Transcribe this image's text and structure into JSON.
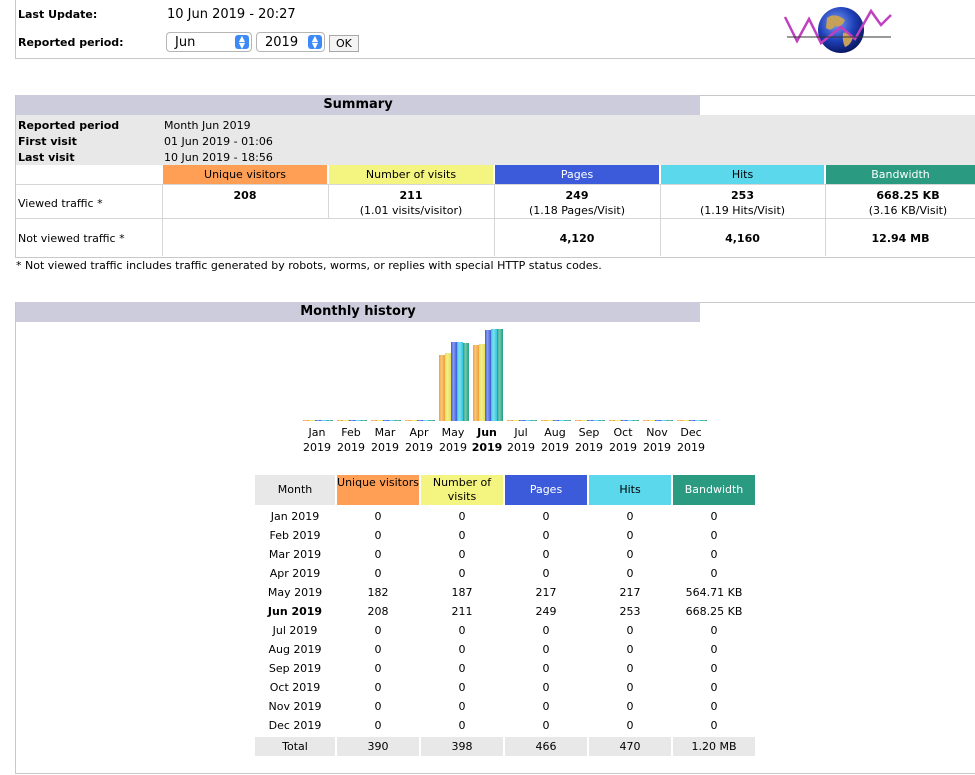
{
  "header": {
    "last_update_label": "Last Update:",
    "last_update_value": "10 Jun 2019 - 20:27",
    "reported_period_label": "Reported period:",
    "month_select": "Jun",
    "year_select": "2019",
    "ok_label": "OK"
  },
  "summary": {
    "title": "Summary",
    "rows": [
      {
        "label": "Reported period",
        "value": "Month Jun 2019"
      },
      {
        "label": "First visit",
        "value": "01 Jun 2019 - 01:06"
      },
      {
        "label": "Last visit",
        "value": "10 Jun 2019 - 18:56"
      }
    ],
    "headers": {
      "unique": "Unique visitors",
      "visits": "Number of visits",
      "pages": "Pages",
      "hits": "Hits",
      "bandwidth": "Bandwidth"
    },
    "viewed": {
      "label": "Viewed traffic *",
      "unique": "208",
      "visits": "211",
      "visits_sub": "(1.01 visits/visitor)",
      "pages": "249",
      "pages_sub": "(1.18 Pages/Visit)",
      "hits": "253",
      "hits_sub": "(1.19 Hits/Visit)",
      "bandwidth": "668.25 KB",
      "bandwidth_sub": "(3.16 KB/Visit)"
    },
    "not_viewed": {
      "label": "Not viewed traffic *",
      "pages": "4,120",
      "hits": "4,160",
      "bandwidth": "12.94 MB"
    },
    "footnote": "* Not viewed traffic includes traffic generated by robots, worms, or replies with special HTTP status codes."
  },
  "history": {
    "title": "Monthly history",
    "months": [
      "Jan",
      "Feb",
      "Mar",
      "Apr",
      "May",
      "Jun",
      "Jul",
      "Aug",
      "Sep",
      "Oct",
      "Nov",
      "Dec"
    ],
    "year": "2019",
    "current_month_index": 5,
    "table_headers": {
      "month": "Month",
      "unique": "Unique visitors",
      "visits": "Number of visits",
      "pages": "Pages",
      "hits": "Hits",
      "bandwidth": "Bandwidth"
    },
    "rows": [
      {
        "month": "Jan 2019",
        "unique": "0",
        "visits": "0",
        "pages": "0",
        "hits": "0",
        "bandwidth": "0"
      },
      {
        "month": "Feb 2019",
        "unique": "0",
        "visits": "0",
        "pages": "0",
        "hits": "0",
        "bandwidth": "0"
      },
      {
        "month": "Mar 2019",
        "unique": "0",
        "visits": "0",
        "pages": "0",
        "hits": "0",
        "bandwidth": "0"
      },
      {
        "month": "Apr 2019",
        "unique": "0",
        "visits": "0",
        "pages": "0",
        "hits": "0",
        "bandwidth": "0"
      },
      {
        "month": "May 2019",
        "unique": "182",
        "visits": "187",
        "pages": "217",
        "hits": "217",
        "bandwidth": "564.71 KB"
      },
      {
        "month": "Jun 2019",
        "unique": "208",
        "visits": "211",
        "pages": "249",
        "hits": "253",
        "bandwidth": "668.25 KB"
      },
      {
        "month": "Jul 2019",
        "unique": "0",
        "visits": "0",
        "pages": "0",
        "hits": "0",
        "bandwidth": "0"
      },
      {
        "month": "Aug 2019",
        "unique": "0",
        "visits": "0",
        "pages": "0",
        "hits": "0",
        "bandwidth": "0"
      },
      {
        "month": "Sep 2019",
        "unique": "0",
        "visits": "0",
        "pages": "0",
        "hits": "0",
        "bandwidth": "0"
      },
      {
        "month": "Oct 2019",
        "unique": "0",
        "visits": "0",
        "pages": "0",
        "hits": "0",
        "bandwidth": "0"
      },
      {
        "month": "Nov 2019",
        "unique": "0",
        "visits": "0",
        "pages": "0",
        "hits": "0",
        "bandwidth": "0"
      },
      {
        "month": "Dec 2019",
        "unique": "0",
        "visits": "0",
        "pages": "0",
        "hits": "0",
        "bandwidth": "0"
      }
    ],
    "total": {
      "month": "Total",
      "unique": "390",
      "visits": "398",
      "pages": "466",
      "hits": "470",
      "bandwidth": "1.20 MB"
    }
  },
  "colors": {
    "unique": "#ff9f56",
    "visits": "#f4f480",
    "pages": "#3b5bdb",
    "hits": "#5cd8ec",
    "bandwidth": "#2a9a80",
    "title_bar": "#ccccdd"
  },
  "chart_data": {
    "type": "bar",
    "categories": [
      "Jan 2019",
      "Feb 2019",
      "Mar 2019",
      "Apr 2019",
      "May 2019",
      "Jun 2019",
      "Jul 2019",
      "Aug 2019",
      "Sep 2019",
      "Oct 2019",
      "Nov 2019",
      "Dec 2019"
    ],
    "series": [
      {
        "name": "Unique visitors",
        "values": [
          0,
          0,
          0,
          0,
          182,
          208,
          0,
          0,
          0,
          0,
          0,
          0
        ]
      },
      {
        "name": "Number of visits",
        "values": [
          0,
          0,
          0,
          0,
          187,
          211,
          0,
          0,
          0,
          0,
          0,
          0
        ]
      },
      {
        "name": "Pages",
        "values": [
          0,
          0,
          0,
          0,
          217,
          249,
          0,
          0,
          0,
          0,
          0,
          0
        ]
      },
      {
        "name": "Hits",
        "values": [
          0,
          0,
          0,
          0,
          217,
          253,
          0,
          0,
          0,
          0,
          0,
          0
        ]
      },
      {
        "name": "Bandwidth",
        "values": [
          0,
          0,
          0,
          0,
          564.71,
          668.25,
          0,
          0,
          0,
          0,
          0,
          0
        ]
      }
    ]
  }
}
